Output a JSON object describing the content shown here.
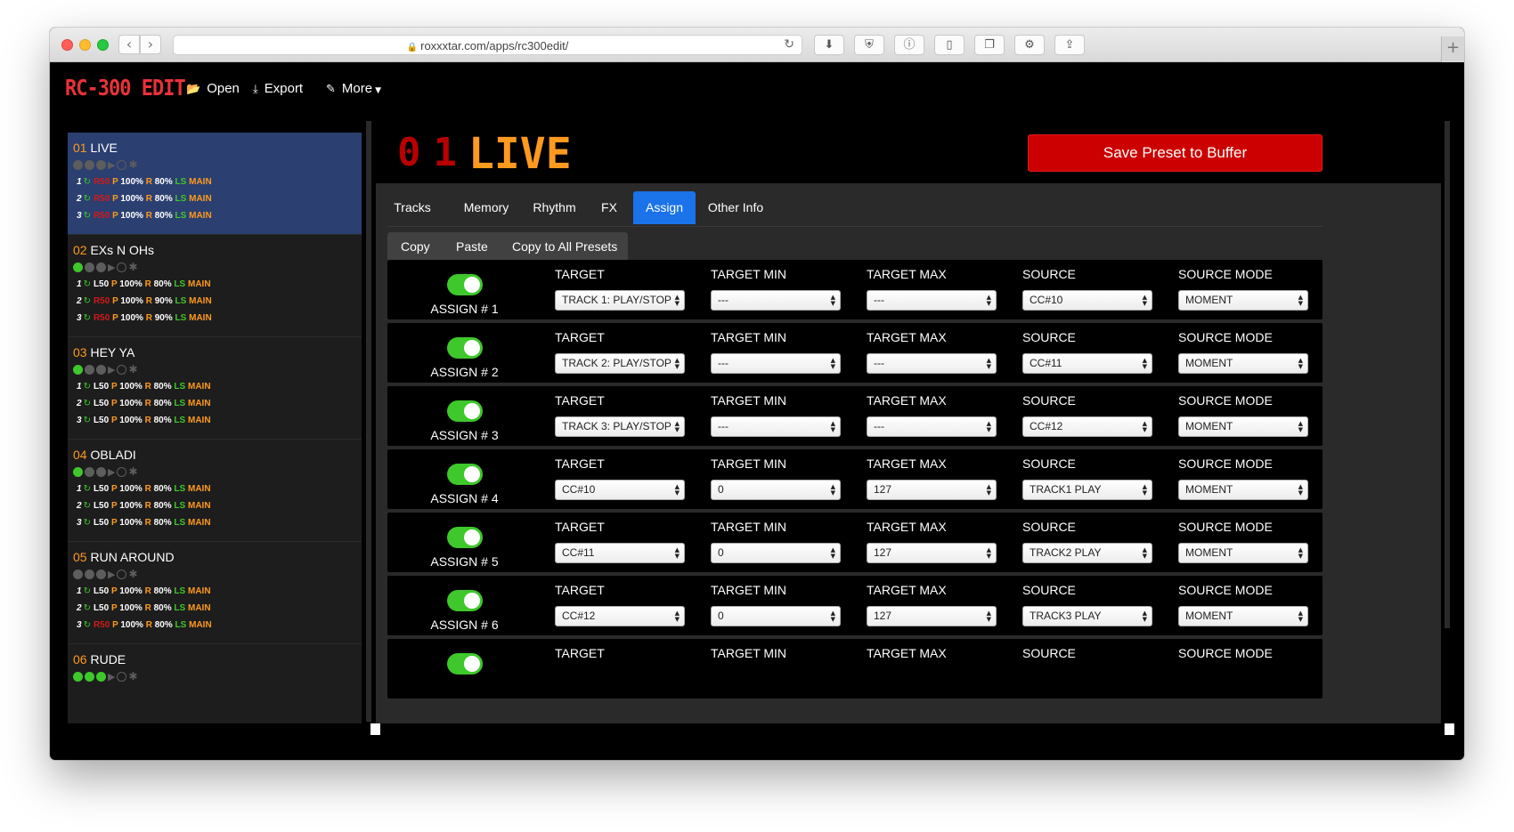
{
  "browser": {
    "url": "roxxxtar.com/apps/rc300edit/",
    "toolbar_icons": [
      "download-icon",
      "shield-icon",
      "info-icon",
      "sidebar-icon",
      "tabs-icon",
      "gear-icon",
      "share-icon"
    ]
  },
  "nav": {
    "brand": "RC-300 EDIT",
    "open": "Open",
    "export": "Export",
    "more": "More"
  },
  "sidebar": {
    "presets": [
      {
        "num": "01",
        "name": "LIVE",
        "active": true,
        "dots": [
          "off",
          "off",
          "off",
          "play",
          "ring",
          "ast"
        ],
        "tracks": [
          {
            "n": "1",
            "level": "R50",
            "level_red": true,
            "p": "100%",
            "r": "80%"
          },
          {
            "n": "2",
            "level": "R50",
            "level_red": true,
            "p": "100%",
            "r": "80%"
          },
          {
            "n": "3",
            "level": "R50",
            "level_red": true,
            "p": "100%",
            "r": "80%"
          }
        ]
      },
      {
        "num": "02",
        "name": "EXs N OHs",
        "active": false,
        "dots": [
          "on",
          "off",
          "off",
          "play",
          "ring",
          "ast"
        ],
        "tracks": [
          {
            "n": "1",
            "level": "L50",
            "level_red": false,
            "p": "100%",
            "r": "80%"
          },
          {
            "n": "2",
            "level": "R50",
            "level_red": true,
            "p": "100%",
            "r": "90%"
          },
          {
            "n": "3",
            "level": "R50",
            "level_red": true,
            "p": "100%",
            "r": "90%"
          }
        ]
      },
      {
        "num": "03",
        "name": "HEY YA",
        "active": false,
        "dots": [
          "on",
          "off",
          "off",
          "play",
          "ring",
          "ast"
        ],
        "tracks": [
          {
            "n": "1",
            "level": "L50",
            "level_red": false,
            "p": "100%",
            "r": "80%"
          },
          {
            "n": "2",
            "level": "L50",
            "level_red": false,
            "p": "100%",
            "r": "80%"
          },
          {
            "n": "3",
            "level": "L50",
            "level_red": false,
            "p": "100%",
            "r": "80%"
          }
        ]
      },
      {
        "num": "04",
        "name": "OBLADI",
        "active": false,
        "dots": [
          "on",
          "off",
          "off",
          "play",
          "ring",
          "ast"
        ],
        "tracks": [
          {
            "n": "1",
            "level": "L50",
            "level_red": false,
            "p": "100%",
            "r": "80%"
          },
          {
            "n": "2",
            "level": "L50",
            "level_red": false,
            "p": "100%",
            "r": "80%"
          },
          {
            "n": "3",
            "level": "L50",
            "level_red": false,
            "p": "100%",
            "r": "80%"
          }
        ]
      },
      {
        "num": "05",
        "name": "RUN AROUND",
        "active": false,
        "dots": [
          "off",
          "off",
          "off",
          "play",
          "ring",
          "ast"
        ],
        "tracks": [
          {
            "n": "1",
            "level": "L50",
            "level_red": false,
            "p": "100%",
            "r": "80%"
          },
          {
            "n": "2",
            "level": "L50",
            "level_red": false,
            "p": "100%",
            "r": "80%"
          },
          {
            "n": "3",
            "level": "R50",
            "level_red": true,
            "p": "100%",
            "r": "80%"
          }
        ]
      },
      {
        "num": "06",
        "name": "RUDE",
        "active": false,
        "dots": [
          "on",
          "on",
          "on",
          "play",
          "ring",
          "ast"
        ],
        "tracks": []
      }
    ],
    "labels": {
      "p": "P",
      "r": "R",
      "ls": "LS",
      "main": "MAIN"
    }
  },
  "header": {
    "lcd": "01",
    "preset_name": "LIVE",
    "save_button": "Save Preset to Buffer"
  },
  "tabs": [
    "Tracks",
    "Memory",
    "Rhythm",
    "FX",
    "Assign",
    "Other Info"
  ],
  "active_tab": "Assign",
  "subtabs": [
    "Copy",
    "Paste",
    "Copy to All Presets"
  ],
  "columns": [
    "TARGET",
    "TARGET MIN",
    "TARGET MAX",
    "SOURCE",
    "SOURCE MODE"
  ],
  "assigns": [
    {
      "label": "ASSIGN # 1",
      "enabled": true,
      "target": "TRACK 1: PLAY/STOP",
      "target_min": "---",
      "target_max": "---",
      "source": "CC#10",
      "source_mode": "MOMENT"
    },
    {
      "label": "ASSIGN # 2",
      "enabled": true,
      "target": "TRACK 2: PLAY/STOP",
      "target_min": "---",
      "target_max": "---",
      "source": "CC#11",
      "source_mode": "MOMENT"
    },
    {
      "label": "ASSIGN # 3",
      "enabled": true,
      "target": "TRACK 3: PLAY/STOP",
      "target_min": "---",
      "target_max": "---",
      "source": "CC#12",
      "source_mode": "MOMENT"
    },
    {
      "label": "ASSIGN # 4",
      "enabled": true,
      "target": "CC#10",
      "target_min": "0",
      "target_max": "127",
      "source": "TRACK1 PLAY",
      "source_mode": "MOMENT"
    },
    {
      "label": "ASSIGN # 5",
      "enabled": true,
      "target": "CC#11",
      "target_min": "0",
      "target_max": "127",
      "source": "TRACK2 PLAY",
      "source_mode": "MOMENT"
    },
    {
      "label": "ASSIGN # 6",
      "enabled": true,
      "target": "CC#12",
      "target_min": "0",
      "target_max": "127",
      "source": "TRACK3 PLAY",
      "source_mode": "MOMENT"
    },
    {
      "label": "",
      "enabled": true,
      "target": "",
      "target_min": "",
      "target_max": "",
      "source": "",
      "source_mode": ""
    }
  ],
  "colors": {
    "brand_red": "#e8323a",
    "accent_orange": "#ff9a1e",
    "active_preset_bg": "#2b3f70",
    "tab_active": "#1a73e8",
    "save_button": "#cc0000",
    "toggle_on": "#3ec82b"
  }
}
